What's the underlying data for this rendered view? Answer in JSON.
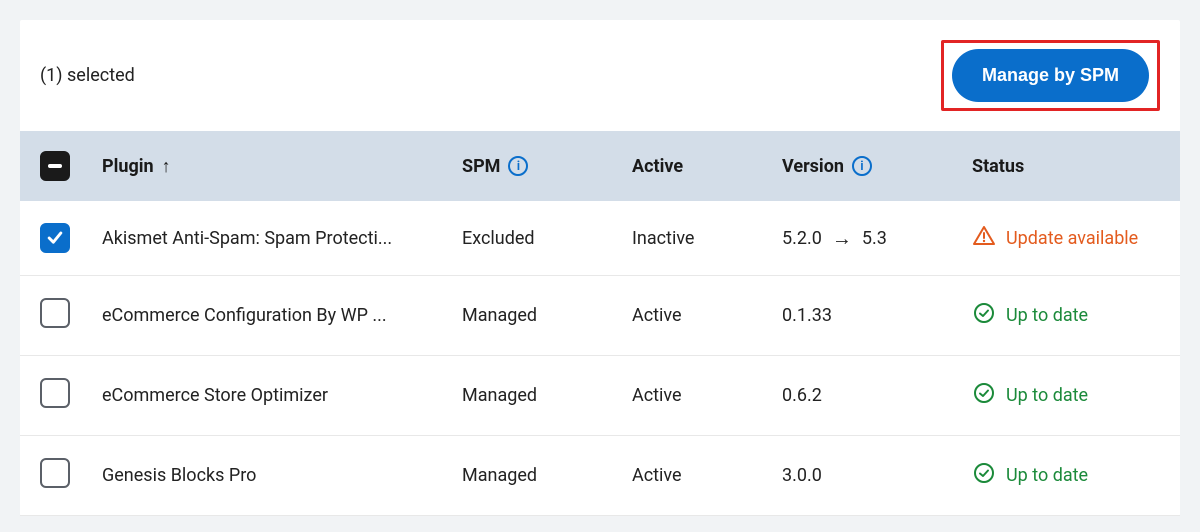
{
  "toolbar": {
    "selected_text": "(1) selected",
    "manage_button": "Manage by SPM"
  },
  "columns": {
    "plugin": "Plugin",
    "spm": "SPM",
    "active": "Active",
    "version": "Version",
    "status": "Status"
  },
  "rows": [
    {
      "checked": true,
      "plugin": "Akismet Anti-Spam: Spam Protecti...",
      "spm": "Excluded",
      "active": "Inactive",
      "version_from": "5.2.0",
      "version_to": "5.3",
      "status": "Update available",
      "status_kind": "update"
    },
    {
      "checked": false,
      "plugin": "eCommerce Configuration By WP ...",
      "spm": "Managed",
      "active": "Active",
      "version_from": "0.1.33",
      "version_to": "",
      "status": "Up to date",
      "status_kind": "ok"
    },
    {
      "checked": false,
      "plugin": "eCommerce Store Optimizer",
      "spm": "Managed",
      "active": "Active",
      "version_from": "0.6.2",
      "version_to": "",
      "status": "Up to date",
      "status_kind": "ok"
    },
    {
      "checked": false,
      "plugin": "Genesis Blocks Pro",
      "spm": "Managed",
      "active": "Active",
      "version_from": "3.0.0",
      "version_to": "",
      "status": "Up to date",
      "status_kind": "ok"
    }
  ],
  "colors": {
    "primary": "#0a6ecb",
    "warn": "#e35b1e",
    "ok": "#1b8a3a",
    "highlight": "#e22424"
  }
}
